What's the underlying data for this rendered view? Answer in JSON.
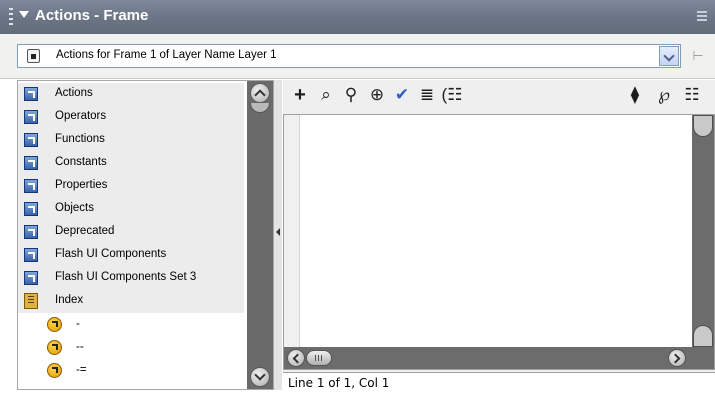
{
  "titlebar": {
    "title": "Actions - Frame"
  },
  "target": {
    "label": "Actions for Frame 1 of Layer Name Layer 1"
  },
  "toolbox": {
    "books": [
      {
        "label": "Actions"
      },
      {
        "label": "Operators"
      },
      {
        "label": "Functions"
      },
      {
        "label": "Constants"
      },
      {
        "label": "Properties"
      },
      {
        "label": "Objects"
      },
      {
        "label": "Deprecated"
      },
      {
        "label": "Flash UI Components"
      },
      {
        "label": "Flash UI Components Set 3"
      },
      {
        "label": "Index"
      }
    ],
    "index_items": [
      {
        "label": "-"
      },
      {
        "label": "--"
      },
      {
        "label": "-="
      }
    ]
  },
  "toolbar": {
    "icons": [
      "add-statement-icon",
      "find-icon",
      "replace-icon",
      "insert-target-path-icon",
      "check-syntax-icon",
      "auto-format-icon",
      "show-code-hint-icon",
      "reference-icon",
      "debug-options-icon",
      "view-options-icon"
    ]
  },
  "status": {
    "text": "Line 1 of 1, Col 1"
  }
}
